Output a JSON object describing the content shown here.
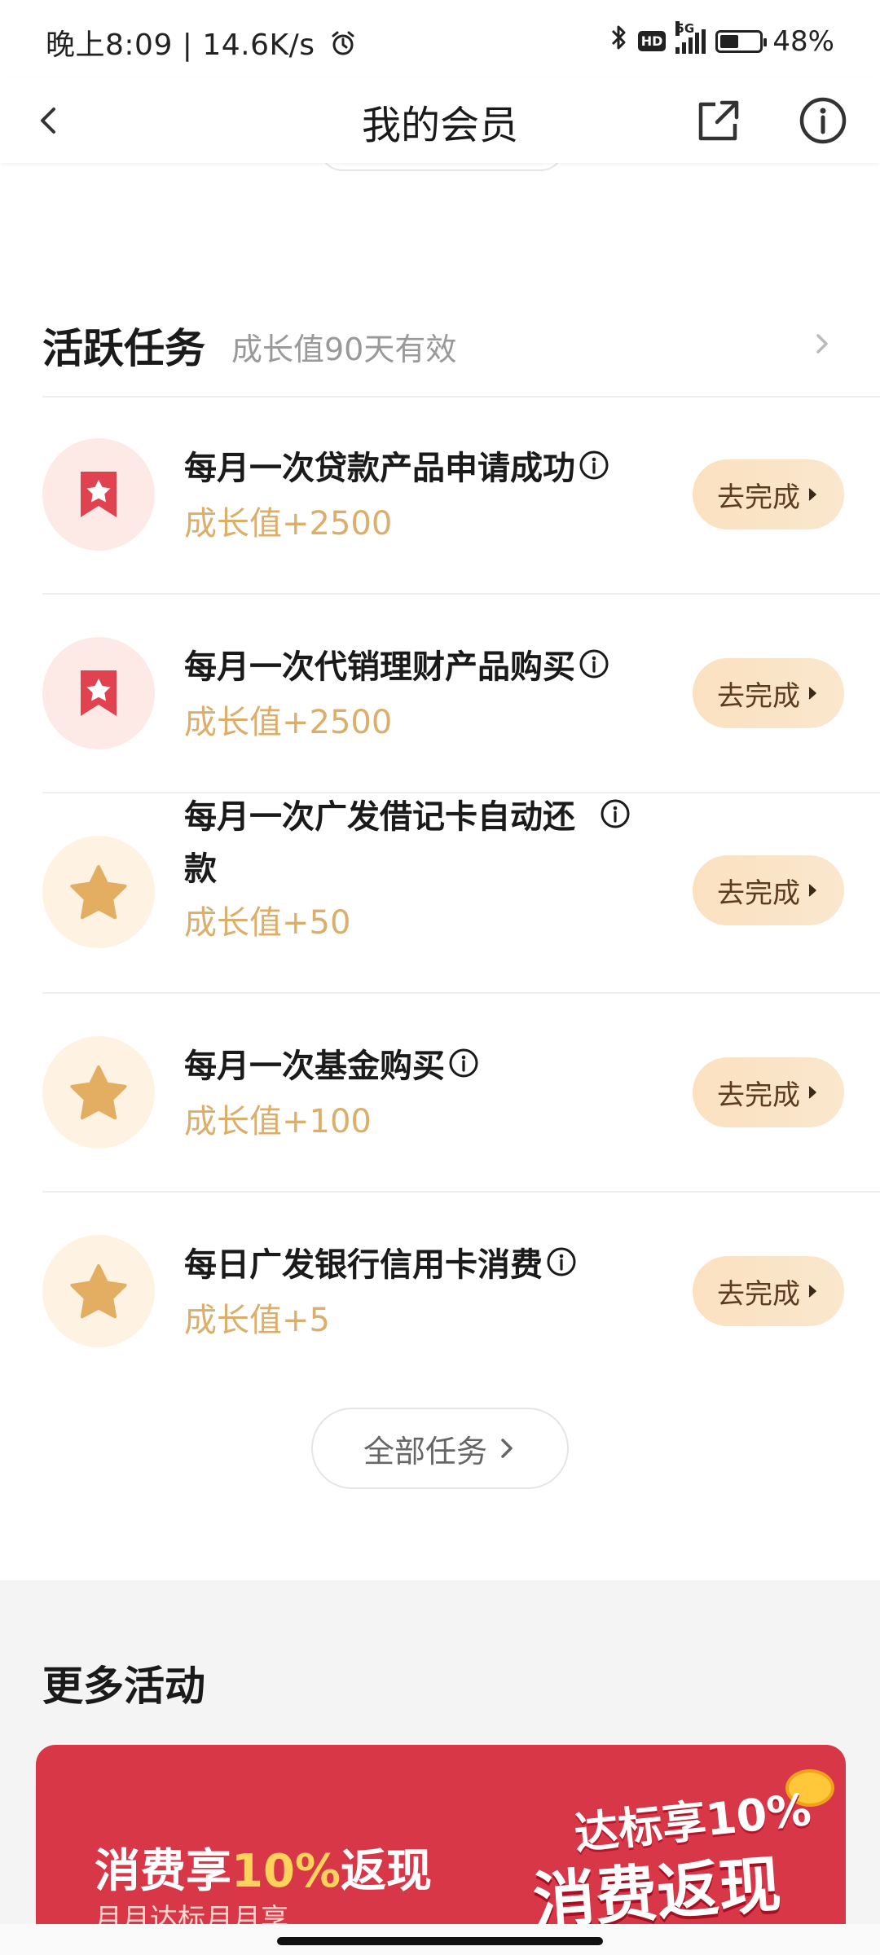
{
  "status_bar": {
    "left_text": "晚上8:09 | 14.6K/s",
    "network": "5G",
    "hd": "HD",
    "battery": "48%",
    "battery_level": 0.48
  },
  "nav": {
    "title": "我的会员"
  },
  "active_tasks": {
    "title": "活跃任务",
    "subtitle": "成长值90天有效",
    "tasks": [
      {
        "title": "每月一次贷款产品申请成功",
        "reward": "成长值+2500",
        "button": "去完成",
        "icon": "bookmark-star-icon",
        "style": "red"
      },
      {
        "title": "每月一次代销理财产品购买",
        "reward": "成长值+2500",
        "button": "去完成",
        "icon": "bookmark-star-icon",
        "style": "red"
      },
      {
        "title_line1": "每月一次广发借记卡自动还",
        "title_line2": "款",
        "reward": "成长值+50",
        "button": "去完成",
        "icon": "star-icon",
        "style": "gold"
      },
      {
        "title": "每月一次基金购买",
        "reward": "成长值+100",
        "button": "去完成",
        "icon": "star-icon",
        "style": "gold"
      },
      {
        "title": "每日广发银行信用卡消费",
        "reward": "成长值+5",
        "button": "去完成",
        "icon": "star-icon",
        "style": "gold"
      }
    ],
    "all_tasks_label": "全部任务"
  },
  "more_activities": {
    "title": "更多活动",
    "banner": {
      "main_prefix": "消费享",
      "main_highlight": "10%",
      "main_suffix": "返现",
      "sub": "月月达标月月享",
      "art_line1": "达标享10%",
      "art_line2": "消费返现"
    }
  },
  "colors": {
    "reward": "#dcae6c",
    "button_bg": "#fbe1c0",
    "red_icon": "#e0424f",
    "gold_icon": "#e3ae62",
    "banner_bg": "#d73747"
  }
}
